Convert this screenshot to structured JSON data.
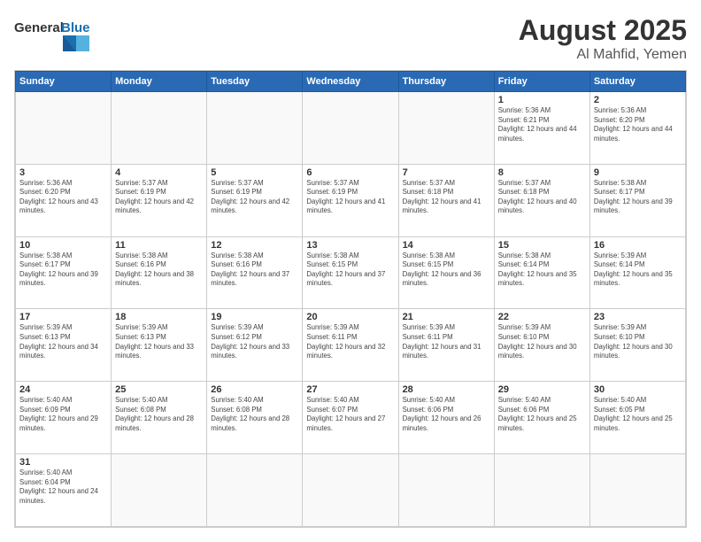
{
  "header": {
    "logo_general": "General",
    "logo_blue": "Blue",
    "title": "August 2025",
    "subtitle": "Al Mahfid, Yemen"
  },
  "weekdays": [
    "Sunday",
    "Monday",
    "Tuesday",
    "Wednesday",
    "Thursday",
    "Friday",
    "Saturday"
  ],
  "weeks": [
    [
      {
        "day": "",
        "info": ""
      },
      {
        "day": "",
        "info": ""
      },
      {
        "day": "",
        "info": ""
      },
      {
        "day": "",
        "info": ""
      },
      {
        "day": "",
        "info": ""
      },
      {
        "day": "1",
        "info": "Sunrise: 5:36 AM\nSunset: 6:21 PM\nDaylight: 12 hours and 44 minutes."
      },
      {
        "day": "2",
        "info": "Sunrise: 5:36 AM\nSunset: 6:20 PM\nDaylight: 12 hours and 44 minutes."
      }
    ],
    [
      {
        "day": "3",
        "info": "Sunrise: 5:36 AM\nSunset: 6:20 PM\nDaylight: 12 hours and 43 minutes."
      },
      {
        "day": "4",
        "info": "Sunrise: 5:37 AM\nSunset: 6:19 PM\nDaylight: 12 hours and 42 minutes."
      },
      {
        "day": "5",
        "info": "Sunrise: 5:37 AM\nSunset: 6:19 PM\nDaylight: 12 hours and 42 minutes."
      },
      {
        "day": "6",
        "info": "Sunrise: 5:37 AM\nSunset: 6:19 PM\nDaylight: 12 hours and 41 minutes."
      },
      {
        "day": "7",
        "info": "Sunrise: 5:37 AM\nSunset: 6:18 PM\nDaylight: 12 hours and 41 minutes."
      },
      {
        "day": "8",
        "info": "Sunrise: 5:37 AM\nSunset: 6:18 PM\nDaylight: 12 hours and 40 minutes."
      },
      {
        "day": "9",
        "info": "Sunrise: 5:38 AM\nSunset: 6:17 PM\nDaylight: 12 hours and 39 minutes."
      }
    ],
    [
      {
        "day": "10",
        "info": "Sunrise: 5:38 AM\nSunset: 6:17 PM\nDaylight: 12 hours and 39 minutes."
      },
      {
        "day": "11",
        "info": "Sunrise: 5:38 AM\nSunset: 6:16 PM\nDaylight: 12 hours and 38 minutes."
      },
      {
        "day": "12",
        "info": "Sunrise: 5:38 AM\nSunset: 6:16 PM\nDaylight: 12 hours and 37 minutes."
      },
      {
        "day": "13",
        "info": "Sunrise: 5:38 AM\nSunset: 6:15 PM\nDaylight: 12 hours and 37 minutes."
      },
      {
        "day": "14",
        "info": "Sunrise: 5:38 AM\nSunset: 6:15 PM\nDaylight: 12 hours and 36 minutes."
      },
      {
        "day": "15",
        "info": "Sunrise: 5:38 AM\nSunset: 6:14 PM\nDaylight: 12 hours and 35 minutes."
      },
      {
        "day": "16",
        "info": "Sunrise: 5:39 AM\nSunset: 6:14 PM\nDaylight: 12 hours and 35 minutes."
      }
    ],
    [
      {
        "day": "17",
        "info": "Sunrise: 5:39 AM\nSunset: 6:13 PM\nDaylight: 12 hours and 34 minutes."
      },
      {
        "day": "18",
        "info": "Sunrise: 5:39 AM\nSunset: 6:13 PM\nDaylight: 12 hours and 33 minutes."
      },
      {
        "day": "19",
        "info": "Sunrise: 5:39 AM\nSunset: 6:12 PM\nDaylight: 12 hours and 33 minutes."
      },
      {
        "day": "20",
        "info": "Sunrise: 5:39 AM\nSunset: 6:11 PM\nDaylight: 12 hours and 32 minutes."
      },
      {
        "day": "21",
        "info": "Sunrise: 5:39 AM\nSunset: 6:11 PM\nDaylight: 12 hours and 31 minutes."
      },
      {
        "day": "22",
        "info": "Sunrise: 5:39 AM\nSunset: 6:10 PM\nDaylight: 12 hours and 30 minutes."
      },
      {
        "day": "23",
        "info": "Sunrise: 5:39 AM\nSunset: 6:10 PM\nDaylight: 12 hours and 30 minutes."
      }
    ],
    [
      {
        "day": "24",
        "info": "Sunrise: 5:40 AM\nSunset: 6:09 PM\nDaylight: 12 hours and 29 minutes."
      },
      {
        "day": "25",
        "info": "Sunrise: 5:40 AM\nSunset: 6:08 PM\nDaylight: 12 hours and 28 minutes."
      },
      {
        "day": "26",
        "info": "Sunrise: 5:40 AM\nSunset: 6:08 PM\nDaylight: 12 hours and 28 minutes."
      },
      {
        "day": "27",
        "info": "Sunrise: 5:40 AM\nSunset: 6:07 PM\nDaylight: 12 hours and 27 minutes."
      },
      {
        "day": "28",
        "info": "Sunrise: 5:40 AM\nSunset: 6:06 PM\nDaylight: 12 hours and 26 minutes."
      },
      {
        "day": "29",
        "info": "Sunrise: 5:40 AM\nSunset: 6:06 PM\nDaylight: 12 hours and 25 minutes."
      },
      {
        "day": "30",
        "info": "Sunrise: 5:40 AM\nSunset: 6:05 PM\nDaylight: 12 hours and 25 minutes."
      }
    ],
    [
      {
        "day": "31",
        "info": "Sunrise: 5:40 AM\nSunset: 6:04 PM\nDaylight: 12 hours and 24 minutes."
      },
      {
        "day": "",
        "info": ""
      },
      {
        "day": "",
        "info": ""
      },
      {
        "day": "",
        "info": ""
      },
      {
        "day": "",
        "info": ""
      },
      {
        "day": "",
        "info": ""
      },
      {
        "day": "",
        "info": ""
      }
    ]
  ]
}
